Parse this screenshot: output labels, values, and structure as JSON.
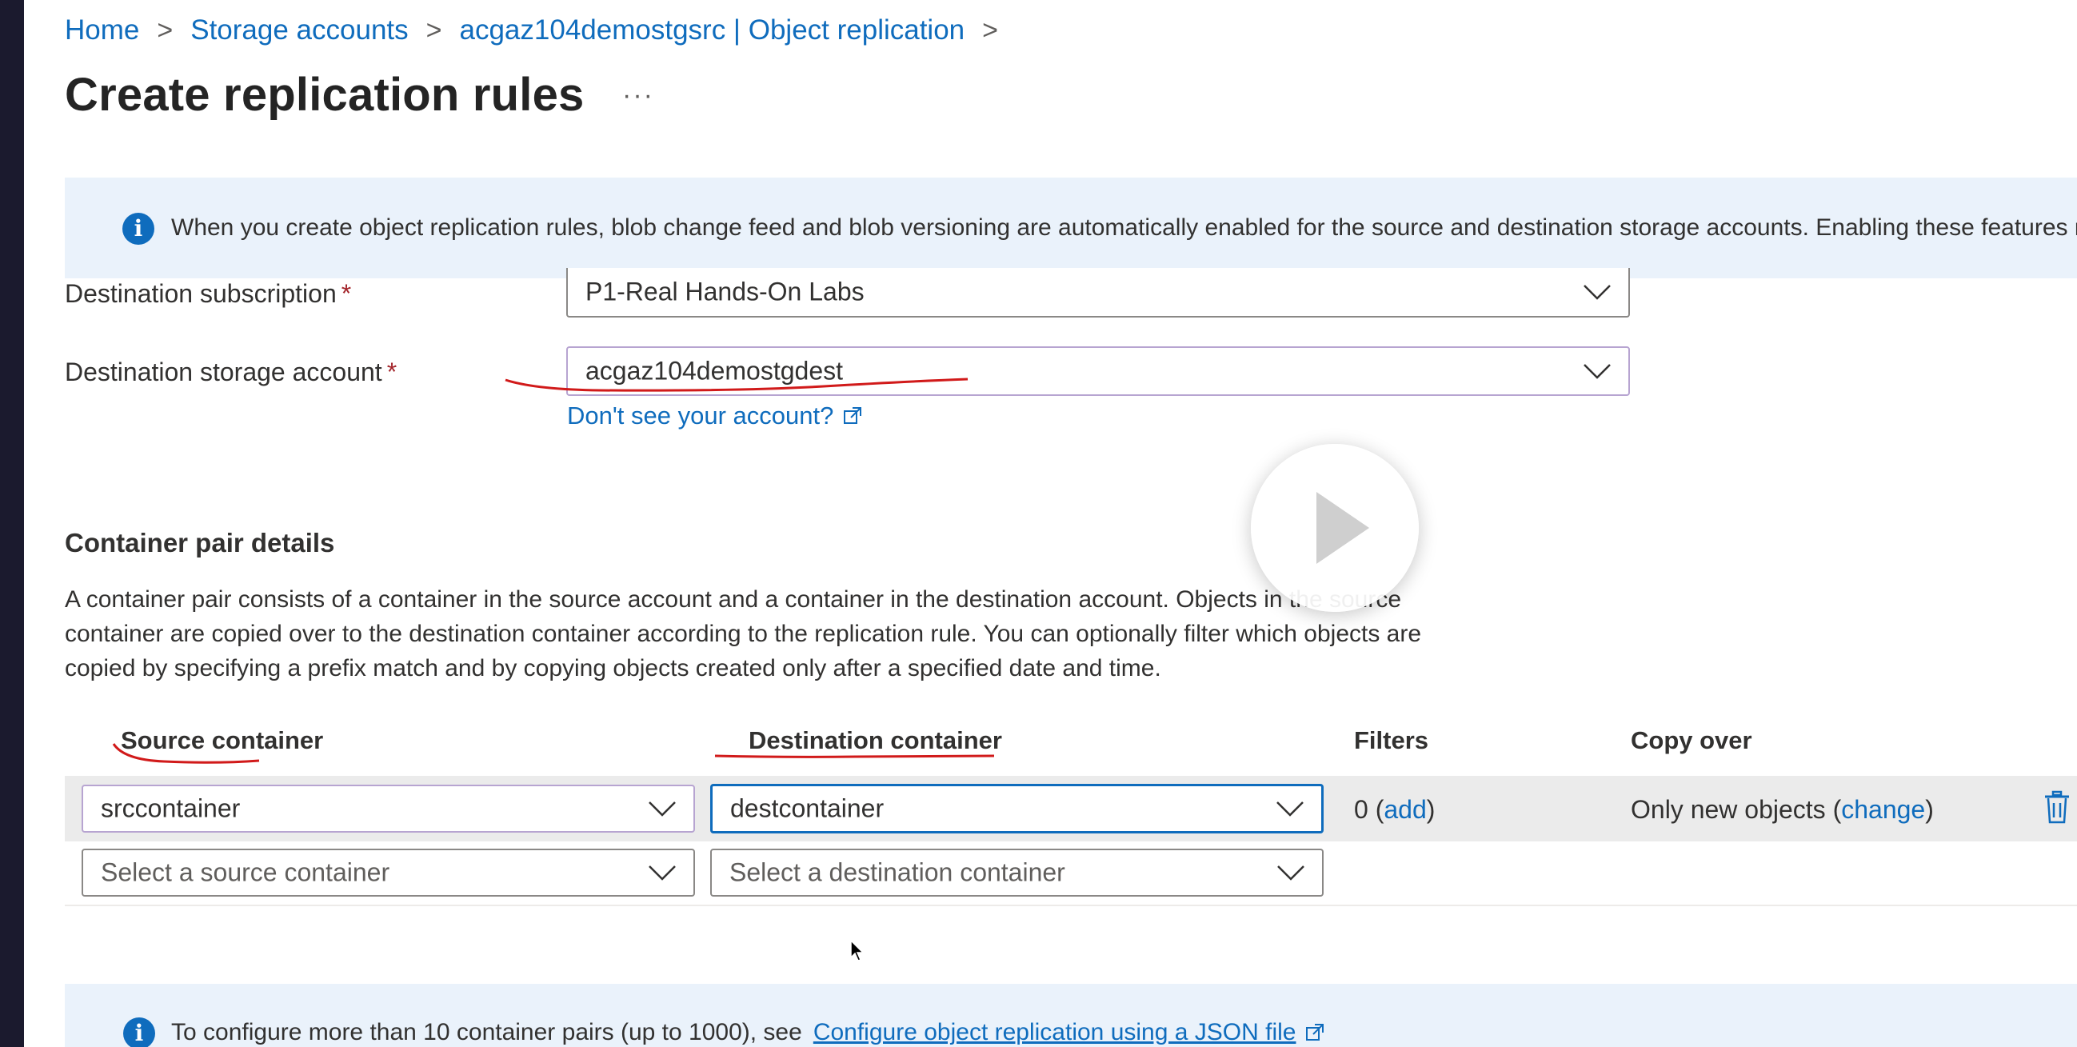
{
  "breadcrumb": {
    "items": [
      "Home",
      "Storage accounts",
      "acgaz104demostgsrc | Object replication"
    ],
    "separator": ">"
  },
  "page": {
    "title": "Create replication rules",
    "more_label": "···"
  },
  "info_banner": {
    "text": "When you create object replication rules, blob change feed and blob versioning are automatically enabled for the source and destination storage accounts. Enabling these features ma"
  },
  "form": {
    "destination_subscription": {
      "label": "Destination subscription",
      "required_mark": "*",
      "value": "P1-Real Hands-On Labs"
    },
    "destination_storage_account": {
      "label": "Destination storage account",
      "required_mark": "*",
      "value": "acgaz104demostgdest"
    },
    "account_help_link": "Don't see your account?"
  },
  "container_pairs": {
    "title": "Container pair details",
    "description": [
      "A container pair consists of a container in the source account and a container in the destination account. Objects in the source",
      "container are copied over to the destination container according to the replication rule. You can optionally filter which objects are",
      "copied by specifying a prefix match and by copying objects created only after a specified date and time."
    ],
    "columns": {
      "source": "Source container",
      "destination": "Destination container",
      "filters": "Filters",
      "copy_over": "Copy over"
    },
    "rows": [
      {
        "source": "srccontainer",
        "destination": "destcontainer",
        "filters_count": "0 (",
        "filters_link": "add",
        "filters_close": ")",
        "copy_over_text": "Only new objects (",
        "copy_over_link": "change",
        "copy_over_close": ")"
      }
    ],
    "new_row": {
      "source_placeholder": "Select a source container",
      "destination_placeholder": "Select a destination container"
    }
  },
  "bottom_banner": {
    "text": "To configure more than 10 container pairs (up to 1000), see",
    "link": "Configure object replication using a JSON file"
  },
  "colors": {
    "accent": "#0f6cbd",
    "required": "#a4262c",
    "annotation": "#d11a1a",
    "info_background": "#eaf2fb"
  },
  "icons": [
    "info-icon",
    "chevron-down-icon",
    "external-link-icon",
    "trash-icon",
    "play-icon",
    "mouse-cursor-icon"
  ]
}
